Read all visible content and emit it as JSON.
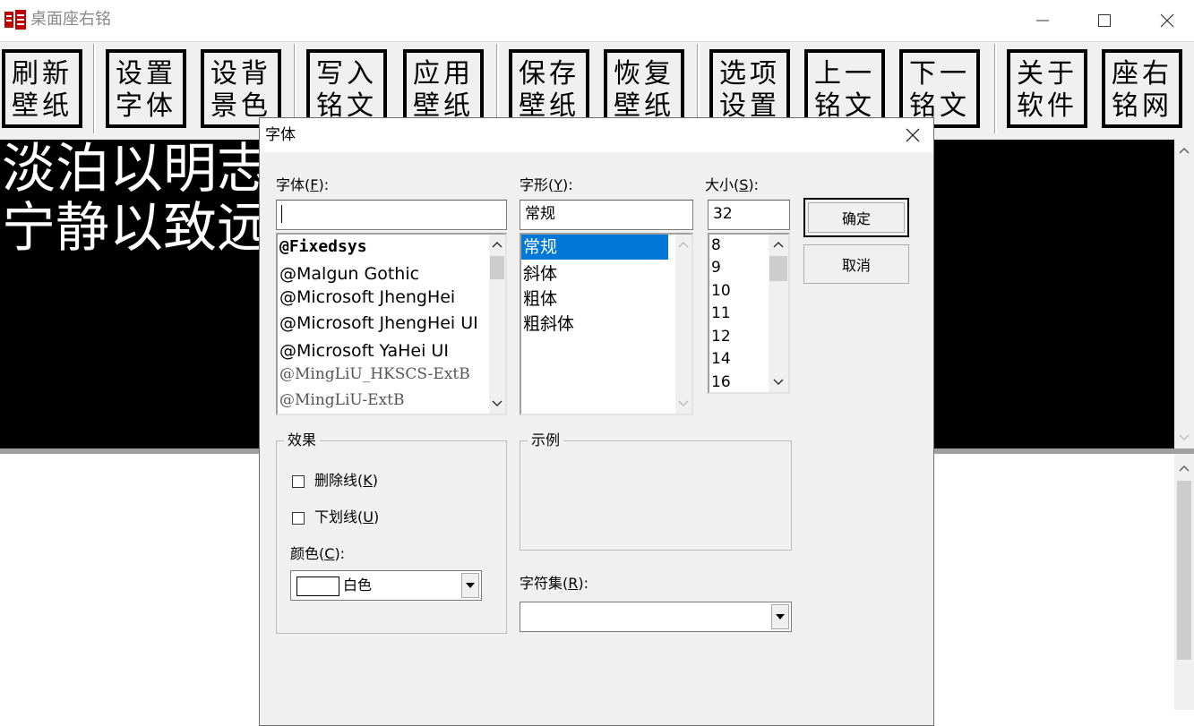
{
  "window": {
    "title": "桌面座右铭"
  },
  "toolbar": {
    "buttons": [
      {
        "line1": "刷新",
        "line2": "壁纸"
      },
      {
        "line1": "设置",
        "line2": "字体"
      },
      {
        "line1": "设背",
        "line2": "景色"
      },
      {
        "line1": "写入",
        "line2": "铭文"
      },
      {
        "line1": "应用",
        "line2": "壁纸"
      },
      {
        "line1": "保存",
        "line2": "壁纸"
      },
      {
        "line1": "恢复",
        "line2": "壁纸"
      },
      {
        "line1": "选项",
        "line2": "设置"
      },
      {
        "line1": "上一",
        "line2": "铭文"
      },
      {
        "line1": "下一",
        "line2": "铭文"
      },
      {
        "line1": "关于",
        "line2": "软件"
      },
      {
        "line1": "座右",
        "line2": "铭网"
      }
    ]
  },
  "motto": {
    "line1": "淡泊以明志",
    "line2": "宁静以致远"
  },
  "dialog": {
    "title": "字体",
    "font": {
      "label": "字体",
      "hotkey": "F",
      "value": "",
      "items": [
        "@Fixedsys",
        "@Malgun Gothic",
        "@Microsoft JhengHei",
        "@Microsoft JhengHei UI",
        "@Microsoft YaHei UI",
        "@MingLiU_HKSCS-ExtB",
        "@MingLiU-ExtB"
      ]
    },
    "style": {
      "label": "字形",
      "hotkey": "Y",
      "value": "常规",
      "items": [
        "常规",
        "斜体",
        "粗体",
        "粗斜体"
      ]
    },
    "size": {
      "label": "大小",
      "hotkey": "S",
      "value": "32",
      "items": [
        "8",
        "9",
        "10",
        "11",
        "12",
        "14",
        "16"
      ]
    },
    "ok_label": "确定",
    "cancel_label": "取消",
    "effects": {
      "legend": "效果",
      "strikeout": {
        "label": "删除线",
        "hotkey": "K"
      },
      "underline": {
        "label": "下划线",
        "hotkey": "U"
      },
      "color": {
        "label": "颜色",
        "hotkey": "C",
        "value": "白色"
      }
    },
    "sample": {
      "legend": "示例"
    },
    "charset": {
      "label": "字符集",
      "hotkey": "R",
      "value": ""
    }
  }
}
